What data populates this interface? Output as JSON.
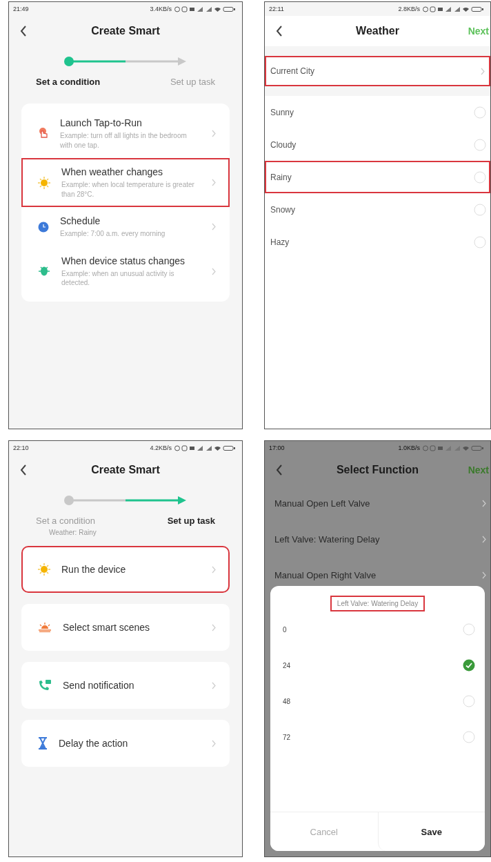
{
  "screens": [
    {
      "kind": "conditions",
      "status": {
        "time": "21:49",
        "speed": "3.4KB/s"
      },
      "title": "Create Smart",
      "steps": [
        {
          "label": "Set a condition",
          "selected": true
        },
        {
          "label": "Set up task",
          "selected": false
        }
      ],
      "cards": [
        {
          "kind": "hand",
          "title": "Launch Tap-to-Run",
          "example": "Example: turn off all lights in the bedroom with one tap.",
          "highlighted": false
        },
        {
          "kind": "sun",
          "title": "When weather changes",
          "example": "Example: when local temperature is greater than 28°C.",
          "highlighted": true
        },
        {
          "kind": "clock",
          "title": "Schedule",
          "example": "Example: 7:00 a.m. every morning",
          "highlighted": false
        },
        {
          "kind": "device",
          "title": "When device status changes",
          "example": "Example: when an unusual activity is detected.",
          "highlighted": false
        }
      ]
    },
    {
      "kind": "list",
      "status": {
        "time": "22:11",
        "speed": "2.8KB/s"
      },
      "title": "Weather",
      "action": "Next",
      "city": {
        "label": "Current City",
        "highlighted": true
      },
      "options": [
        {
          "label": "Sunny",
          "selected": false,
          "highlighted": false
        },
        {
          "label": "Cloudy",
          "selected": false,
          "highlighted": false
        },
        {
          "label": "Rainy",
          "selected": false,
          "highlighted": true
        },
        {
          "label": "Snowy",
          "selected": false,
          "highlighted": false
        },
        {
          "label": "Hazy",
          "selected": false,
          "highlighted": false
        }
      ]
    },
    {
      "kind": "tasks",
      "status": {
        "time": "22:10",
        "speed": "4.2KB/s"
      },
      "title": "Create Smart",
      "steps": [
        {
          "label": "Set a condition",
          "selected": false
        },
        {
          "label": "Set up task",
          "selected": true
        }
      ],
      "step_note": "Weather: Rainy",
      "cards": [
        {
          "kind": "sun",
          "title": "Run the device",
          "highlighted": true
        },
        {
          "kind": "scene",
          "title": "Select smart scenes",
          "highlighted": false
        },
        {
          "kind": "phone",
          "title": "Send notification",
          "highlighted": false
        },
        {
          "kind": "hourglass",
          "title": "Delay the action",
          "highlighted": false
        }
      ]
    },
    {
      "kind": "sheet",
      "status": {
        "time": "17:00",
        "speed": "1.0KB/s"
      },
      "title": "Select Function",
      "action": "Next",
      "functions": [
        "Manual Open Left Valve",
        "Left Valve: Watering Delay",
        "Manual Open Right Valve"
      ],
      "sheet": {
        "title": "Left Valve: Watering Delay",
        "highlighted": true,
        "options": [
          {
            "label": "0",
            "selected": false
          },
          {
            "label": "24",
            "selected": true
          },
          {
            "label": "48",
            "selected": false
          },
          {
            "label": "72",
            "selected": false
          }
        ],
        "buttons": [
          "Cancel",
          "Save"
        ]
      }
    }
  ]
}
